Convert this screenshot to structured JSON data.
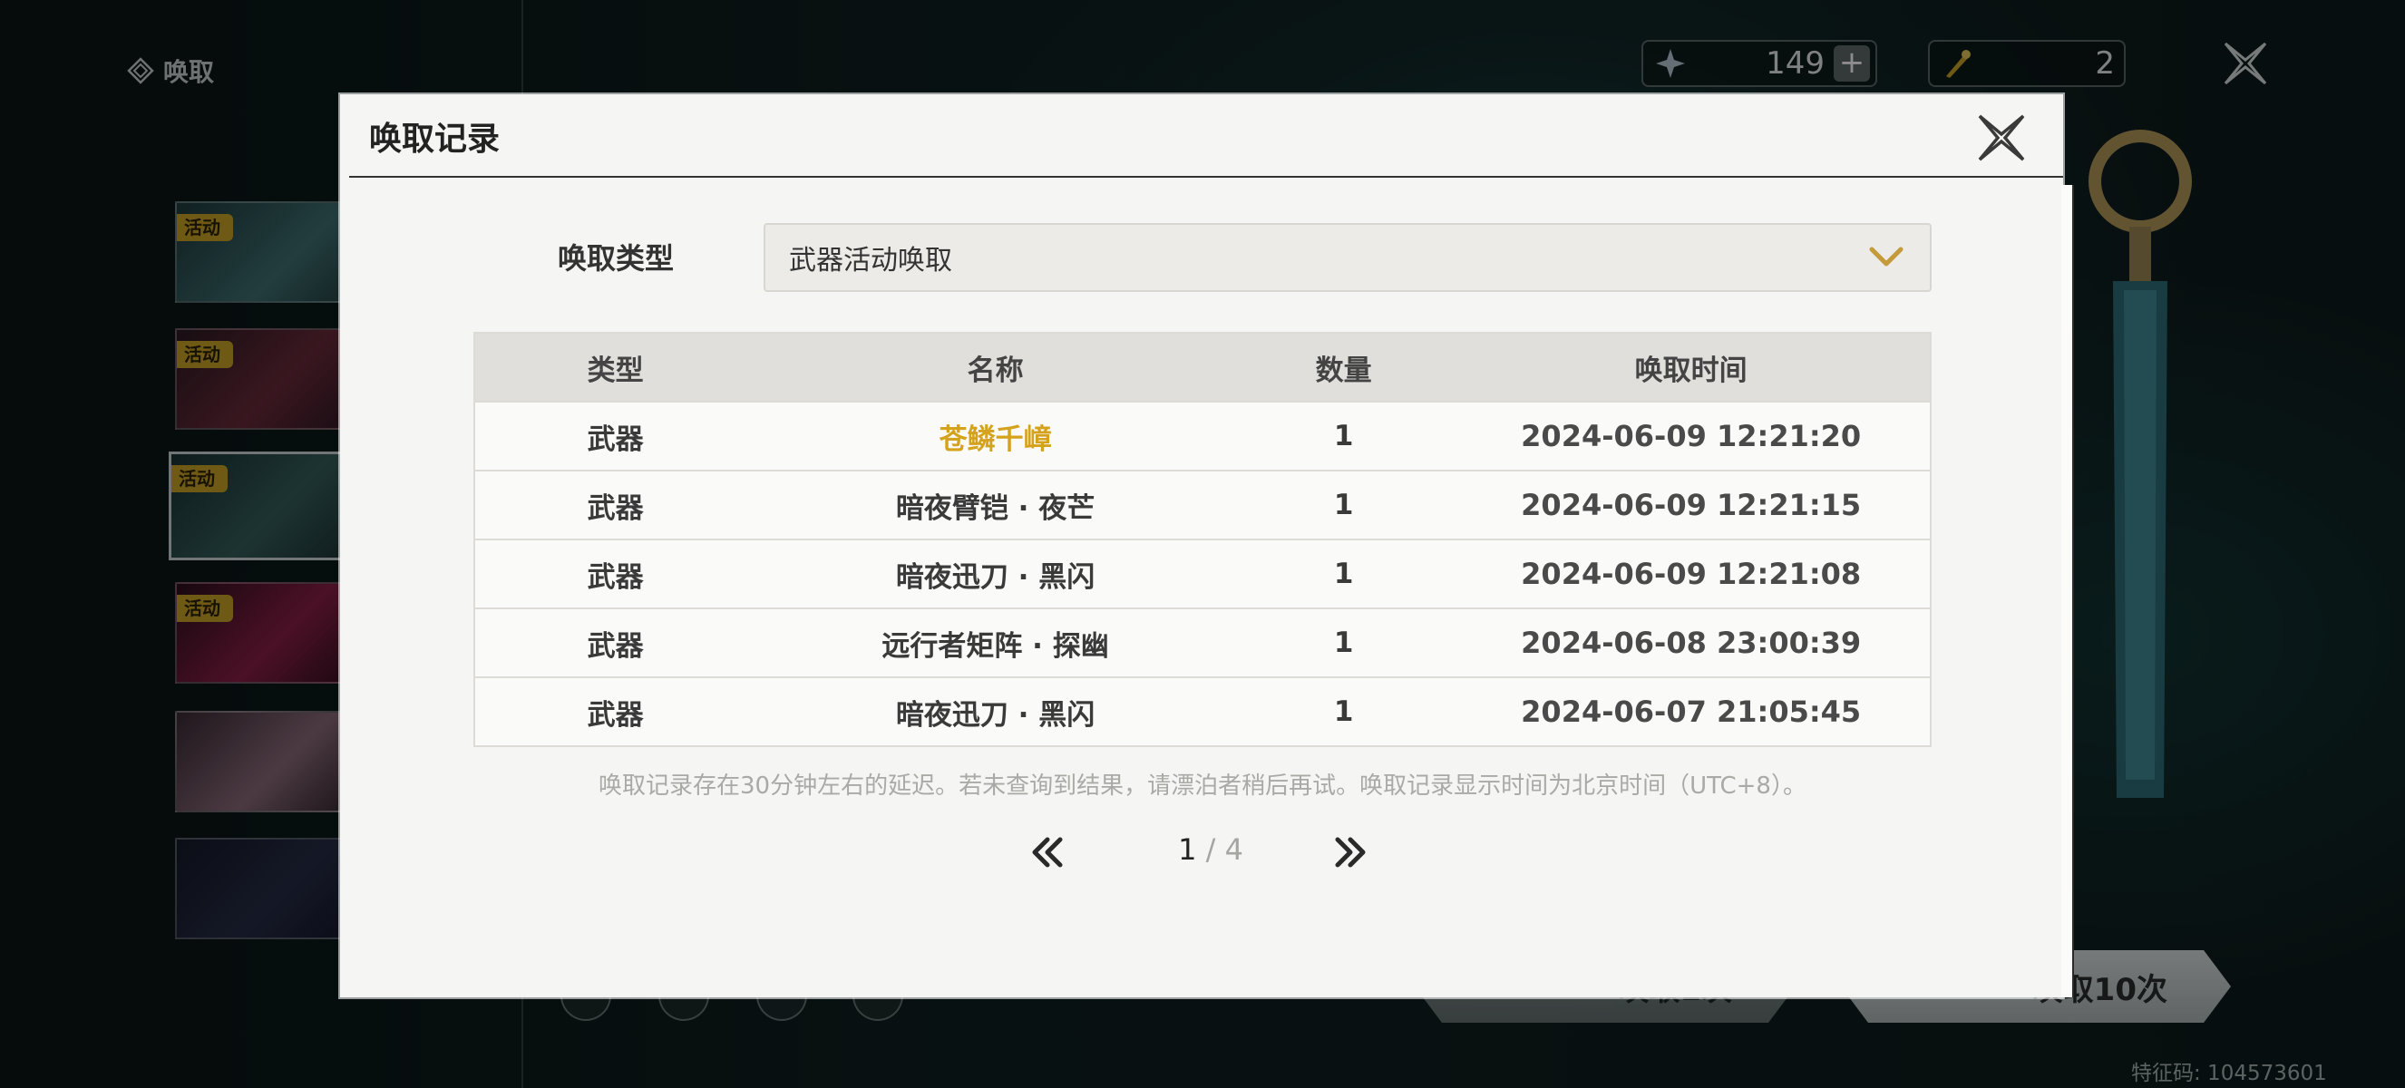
{
  "background": {
    "side_title": "唤取",
    "banners": [
      {
        "tag": "活动"
      },
      {
        "tag": "活动"
      },
      {
        "tag": "活动"
      },
      {
        "tag": "活动"
      },
      {
        "tag": ""
      },
      {
        "tag": ""
      }
    ],
    "currency": [
      {
        "icon": "astrite-icon",
        "value": "149"
      },
      {
        "icon": "forging-tide-icon",
        "value": "2"
      }
    ],
    "pull_buttons": [
      {
        "label": "唤取1次"
      },
      {
        "label": "唤取10次"
      }
    ],
    "feature_code": "特征码: 104573601"
  },
  "modal": {
    "title": "唤取记录",
    "type_label": "唤取类型",
    "type_value": "武器活动唤取",
    "columns": [
      "类型",
      "名称",
      "数量",
      "唤取时间"
    ],
    "rows": [
      {
        "type": "武器",
        "name": "苍鳞千嶂",
        "count": "1",
        "time": "2024-06-09 12:21:20",
        "highlight": true
      },
      {
        "type": "武器",
        "name": "暗夜臂铠 · 夜芒",
        "count": "1",
        "time": "2024-06-09 12:21:15",
        "highlight": false
      },
      {
        "type": "武器",
        "name": "暗夜迅刀 · 黑闪",
        "count": "1",
        "time": "2024-06-09 12:21:08",
        "highlight": false
      },
      {
        "type": "武器",
        "name": "远行者矩阵 · 探幽",
        "count": "1",
        "time": "2024-06-08 23:00:39",
        "highlight": false
      },
      {
        "type": "武器",
        "name": "暗夜迅刀 · 黑闪",
        "count": "1",
        "time": "2024-06-07 21:05:45",
        "highlight": false
      }
    ],
    "notice": "唤取记录存在30分钟左右的延迟。若未查询到结果，请漂泊者稍后再试。唤取记录显示时间为北京时间（UTC+8）。",
    "pagination": {
      "current": "1",
      "separator": "/",
      "total": "4"
    }
  },
  "colors": {
    "highlight_gold": "#d4a21c",
    "tag_gold": "#c9a227",
    "modal_bg": "#f5f5f3"
  }
}
